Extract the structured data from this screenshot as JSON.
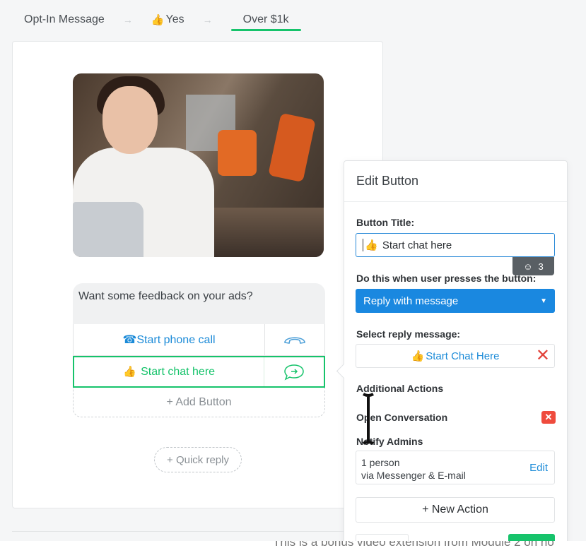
{
  "breadcrumb": {
    "items": [
      "Opt-In Message",
      "Yes",
      "Over $1k"
    ],
    "active": "Over $1k"
  },
  "message": {
    "text": "Want some feedback on your ads?",
    "buttons": [
      {
        "label": "Start phone call",
        "icon": "phone-icon"
      },
      {
        "label": "Start chat here",
        "icon": "chat-icon"
      }
    ],
    "add_button": "+ Add Button",
    "quick_reply": "+ Quick reply"
  },
  "edit_panel": {
    "title": "Edit Button",
    "button_title_label": "Button Title:",
    "button_title_value": "Start chat here",
    "char_counter": "3",
    "action_label": "Do this when user presses the button:",
    "action_value": "Reply with message",
    "reply_label": "Select reply message:",
    "reply_value": "Start Chat Here",
    "additional_actions": "Additional Actions",
    "open_conversation": "Open Conversation",
    "notify_admins": "Notify Admins",
    "admins_count": "1 person",
    "admins_via": "via Messenger & E-mail",
    "edit": "Edit",
    "new_action": "+ New Action"
  },
  "caption": "This is a bonus video extension from Module 2 on ho",
  "colors": {
    "accent_green": "#16c36b",
    "accent_blue": "#1a88e0",
    "danger": "#ef4b3d"
  }
}
